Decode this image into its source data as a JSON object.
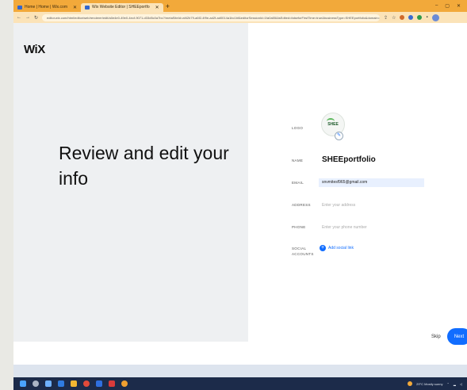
{
  "browser": {
    "tabs": [
      {
        "label": "Home | Home | Wix.com",
        "active": false
      },
      {
        "label": "Wix Website Editor | SHEEportfo",
        "active": true
      }
    ],
    "url": "editor.wix.com/html/editor/web/renderer/edit/a0e4e0-49e0-4ecf-9071-d33d5c0a7bc?/metaSiteId=af42b79-a6f2-4f9e-ad2f-ad0014a1bc1bf&editorSessionId=1fa0a55&isEdited=falseforFirstTime=true&businessType=SHEEportfolio&domain=wixsite.com"
  },
  "wix_logo": "WiX",
  "headline": "Review and edit your info",
  "form": {
    "logo_label": "LOGO",
    "logo_text": "SHEE",
    "name_label": "NAME",
    "name_value": "SHEEportfolio",
    "email_label": "EMAIL",
    "email_value": "snvmitesf965@gmail.com",
    "address_label": "ADDRESS",
    "address_placeholder": "Enter your address",
    "phone_label": "PHONE",
    "phone_placeholder": "Enter your phone number",
    "social_label_1": "SOCIAL",
    "social_label_2": "ACCOUNTS",
    "social_link": "Add social link"
  },
  "footer": {
    "skip": "Skip",
    "next": "Next"
  },
  "taskbar": {
    "weather": "29°C  Mostly sunny"
  },
  "colors": {
    "accent": "#116dff",
    "left_pane": "#eef0f2",
    "browser_chrome": "#f2a93a"
  }
}
